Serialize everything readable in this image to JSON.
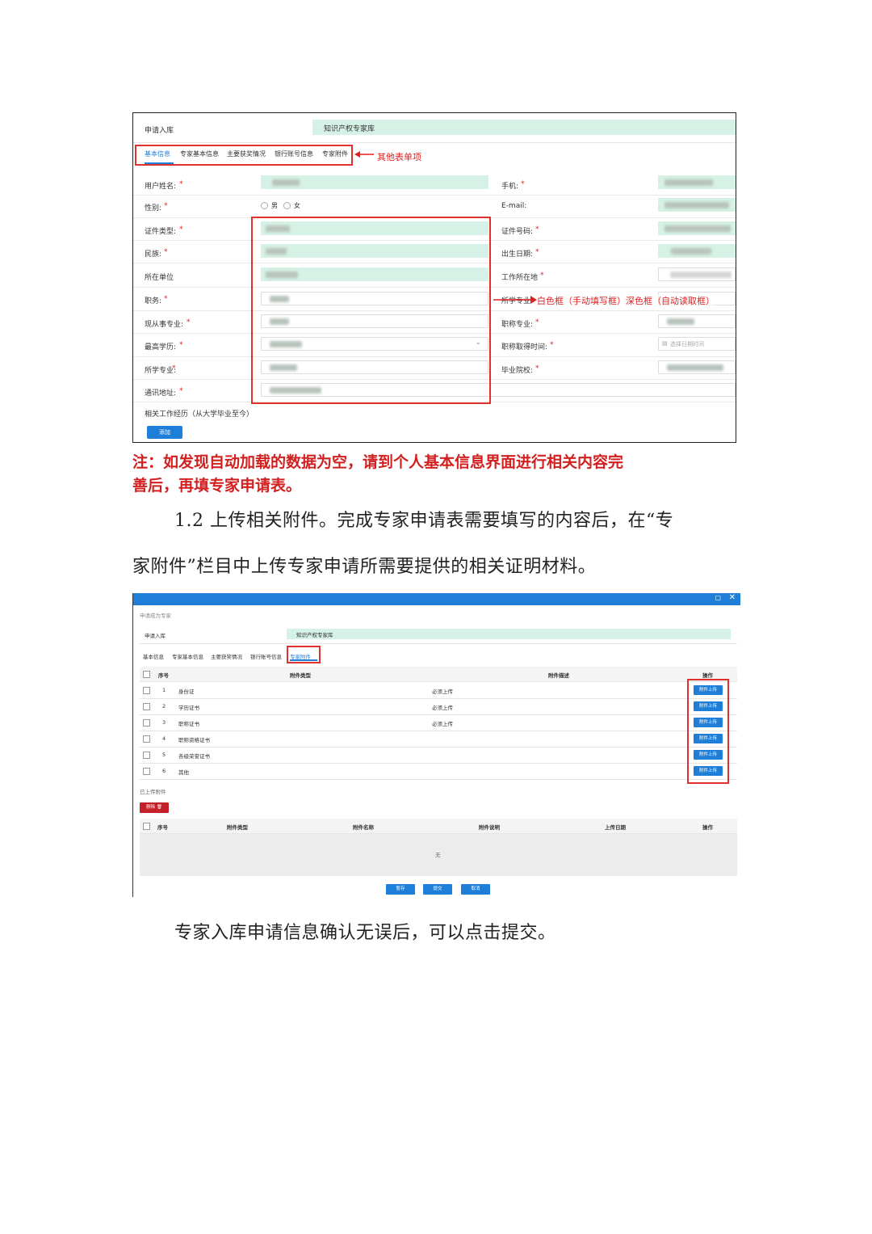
{
  "shot1": {
    "apply_label": "申请入库",
    "library_value": "知识产权专家库",
    "tabs": [
      "基本信息",
      "专家基本信息",
      "主要获奖情况",
      "银行账号信息",
      "专家附件"
    ],
    "tabs_annotation": "其他表单项",
    "left_fields": [
      "用户姓名:",
      "性别:",
      "证件类型:",
      "民族:",
      "所在单位",
      "职务:",
      "现从事专业:",
      "最高学历:",
      "所学专业:",
      "通讯地址:"
    ],
    "right_fields": [
      "手机:",
      "E-mail:",
      "证件号码:",
      "出生日期:",
      "工作所在地",
      "所学专业",
      "职称专业:",
      "职称取得时间:",
      "毕业院校:"
    ],
    "required_mark": "*",
    "gender_male": "男",
    "gender_female": "女",
    "date_placeholder": "选择日期时间",
    "box_annotation": "白色框（手动填写框）深色框（自动读取框）",
    "work_history_label": "相关工作经历（从大学毕业至今）",
    "add_button": "添加"
  },
  "note_line1": "注：如发现自动加载的数据为空，请到个人基本信息界面进行相关内容完",
  "note_line2": "善后，再填专家申请表。",
  "para1_line1": "1.2 上传相关附件。完成专家申请表需要填写的内容后，在“专",
  "para1_line2": "家附件”栏目中上传专家申请所需要提供的相关证明材料。",
  "shot2": {
    "window_title": "申请成为专家",
    "apply_label": "申请入库",
    "library_value": "知识产权专家库",
    "tabs": [
      "基本信息",
      "专家基本信息",
      "主要获奖情况",
      "银行账号信息",
      "专家附件"
    ],
    "columns": [
      "序号",
      "附件类型",
      "附件描述",
      "操作"
    ],
    "rows": [
      {
        "no": "1",
        "type": "身份证",
        "desc": "必须上传"
      },
      {
        "no": "2",
        "type": "学历证书",
        "desc": "必须上传"
      },
      {
        "no": "3",
        "type": "职称证书",
        "desc": "必须上传"
      },
      {
        "no": "4",
        "type": "职称资格证书",
        "desc": ""
      },
      {
        "no": "5",
        "type": "各级荣誉证书",
        "desc": ""
      },
      {
        "no": "6",
        "type": "其他",
        "desc": ""
      }
    ],
    "upload_button": "附件上传",
    "uploaded_label": "已上传附件",
    "delete_button": "删除",
    "uploaded_columns": [
      "序号",
      "附件类型",
      "附件名称",
      "附件说明",
      "上传日期",
      "操作"
    ],
    "empty_text": "无",
    "footer_buttons": [
      "暂存",
      "提交",
      "取消"
    ]
  },
  "para2": "专家入库申请信息确认无误后，可以点击提交。",
  "colors": {
    "accent": "#1f7fd8",
    "annotation_red": "#e02020",
    "readonly_green": "#d6f1e5"
  }
}
